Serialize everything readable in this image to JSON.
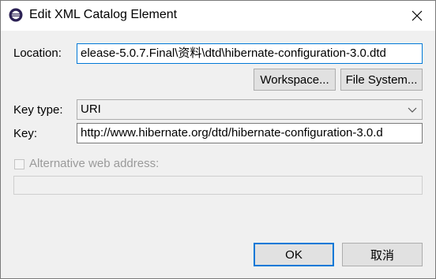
{
  "window": {
    "title": "Edit XML Catalog Element",
    "icon": "eclipse-icon",
    "close_icon": "close-icon"
  },
  "location": {
    "label": "Location:",
    "value": "elease-5.0.7.Final\\资料\\dtd\\hibernate-configuration-3.0.dtd"
  },
  "buttons": {
    "workspace": "Workspace...",
    "file_system": "File System...",
    "ok": "OK",
    "cancel": "取消"
  },
  "key_type": {
    "label": "Key type:",
    "selected": "URI"
  },
  "key": {
    "label": "Key:",
    "value": "http://www.hibernate.org/dtd/hibernate-configuration-3.0.d"
  },
  "alternative": {
    "label": "Alternative web address:",
    "checked": false,
    "value": ""
  },
  "colors": {
    "focus_border": "#0078d7",
    "dialog_bg": "#f0f0f0",
    "disabled_text": "#9a9a9a"
  }
}
